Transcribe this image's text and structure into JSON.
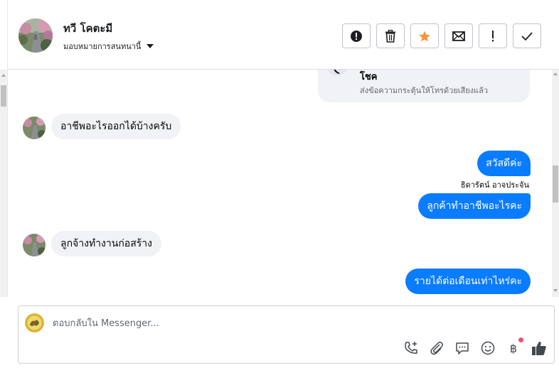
{
  "header": {
    "contact_name": "ทวี โคตะมี",
    "assign_label": "มอบหมายการสนทนานี้",
    "actions": [
      {
        "name": "alert-icon",
        "label": "Mark as spam"
      },
      {
        "name": "trash-icon",
        "label": "Delete"
      },
      {
        "name": "star-icon",
        "label": "Star"
      },
      {
        "name": "envelope-icon",
        "label": "Mark unread"
      },
      {
        "name": "exclamation-icon",
        "label": "Follow up"
      },
      {
        "name": "check-icon",
        "label": "Done"
      }
    ]
  },
  "call_card": {
    "title": "โชค",
    "subtitle": "ส่งข้อความกระตุ้นให้โทรด้วยเสียงแล้ว"
  },
  "messages": [
    {
      "direction": "in",
      "text": "อาชีพอะไรออกได้บ้างครับ"
    },
    {
      "direction": "out",
      "text": "สวัสดีค่ะ"
    },
    {
      "direction": "out",
      "sender": "ธิดารัตน์ อาจประจัน",
      "text": "ลูกค้าทำอาชีพอะไรคะ"
    },
    {
      "direction": "in",
      "text": "ลูกจ้างทำงานก่อสร้าง"
    },
    {
      "direction": "out",
      "text": "รายได้ต่อเดือนเท่าไหร่คะ"
    }
  ],
  "composer": {
    "placeholder": "ตอบกลับใน Messenger...",
    "tools": [
      "phone-plus-icon",
      "paperclip-icon",
      "chat-bubble-icon",
      "smiley-icon",
      "baht-icon",
      "thumbs-up-icon"
    ],
    "baht_symbol": "฿"
  },
  "colors": {
    "outgoing_bubble": "#0a7cff",
    "incoming_bubble": "#f0f2f5",
    "star": "#f7923b",
    "notification_dot": "#f0506e"
  }
}
